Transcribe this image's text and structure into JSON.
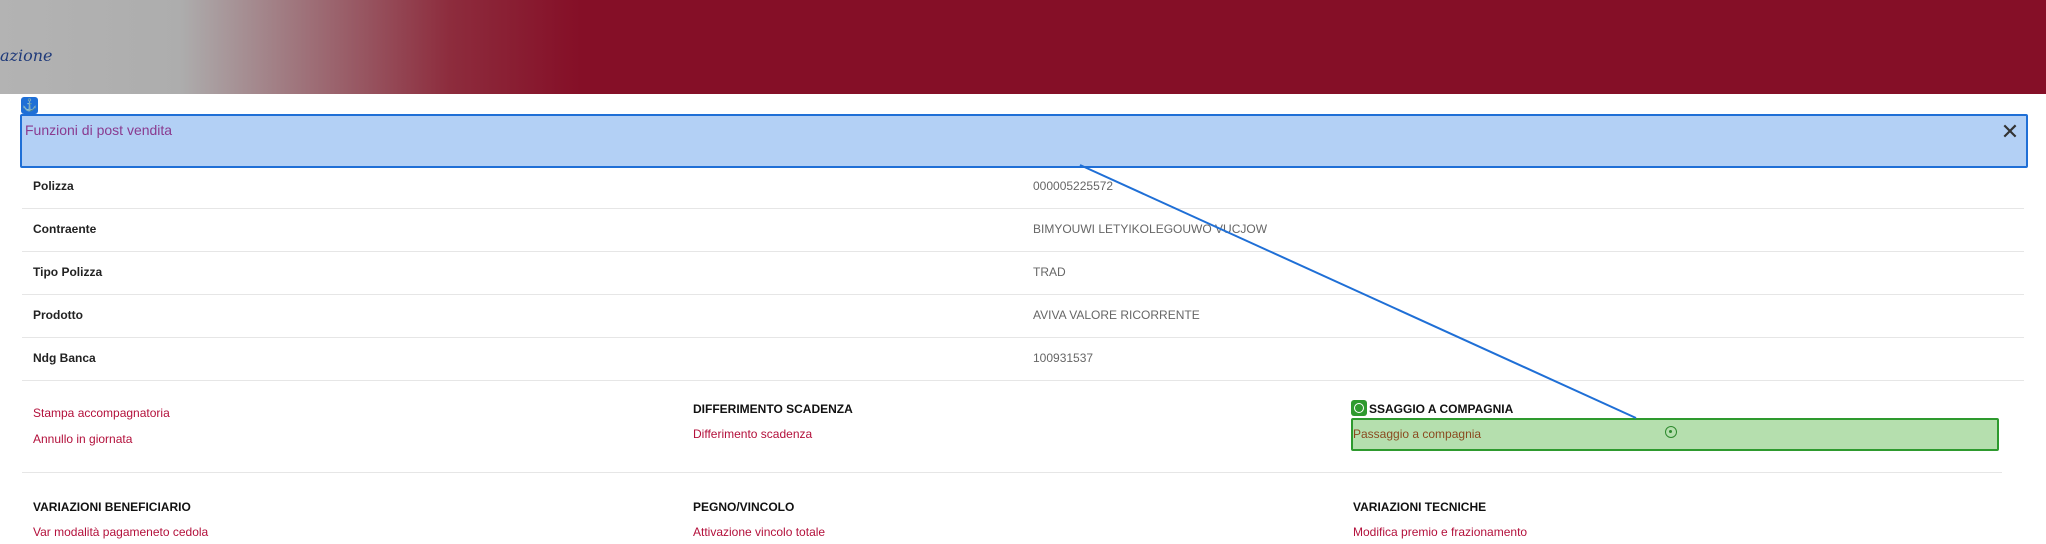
{
  "brand": {
    "text": "azione"
  },
  "header": {
    "title": "Funzioni di post vendita",
    "close_label": "✕"
  },
  "details": [
    {
      "label": "Polizza",
      "value": "000005225572"
    },
    {
      "label": "Contraente",
      "value": "BIMYOUWI LETYIKOLEGOUWO VUCJOW"
    },
    {
      "label": "Tipo Polizza",
      "value": "TRAD"
    },
    {
      "label": "Prodotto",
      "value": "AVIVA VALORE RICORRENTE"
    },
    {
      "label": "Ndg Banca",
      "value": "100931537"
    }
  ],
  "groups": {
    "stampa": {
      "items": [
        "Stampa accompagnatoria",
        "Annullo in giornata"
      ]
    },
    "differimento": {
      "title": "DIFFERIMENTO SCADENZA",
      "items": [
        "Differimento scadenza"
      ]
    },
    "passaggio": {
      "title": "SSAGGIO A COMPAGNIA",
      "items": [
        "Passaggio a compagnia"
      ]
    },
    "beneficiario": {
      "title": "VARIAZIONI BENEFICIARIO",
      "items": [
        "Var modalità pagameneto cedola"
      ]
    },
    "pegno": {
      "title": "PEGNO/VINCOLO",
      "items": [
        "Attivazione vincolo totale"
      ]
    },
    "tecniche": {
      "title": "VARIAZIONI TECNICHE",
      "items": [
        "Modifica premio e frazionamento"
      ]
    }
  },
  "icons": {
    "anchor": "anchor-icon",
    "close": "close-icon",
    "target": "target-icon",
    "crosshair": "crosshair-icon"
  },
  "colors": {
    "topbar": "#850f27",
    "header_highlight": "#b3d0f5",
    "header_border": "#1f6fd6",
    "link": "#b3103b",
    "green_highlight": "#b5dfae",
    "green_border": "#2e9a2e"
  }
}
